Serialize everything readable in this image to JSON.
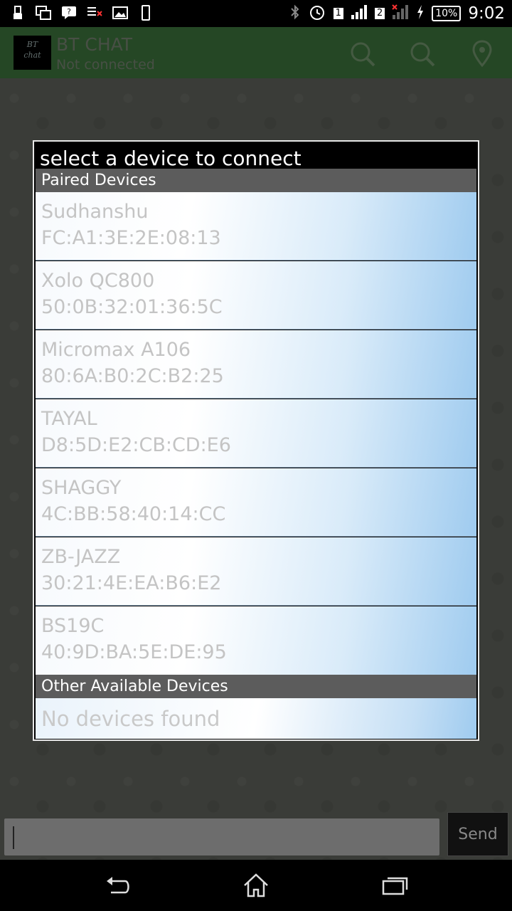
{
  "status_bar": {
    "sim1": "1",
    "sim2": "2",
    "battery": "10%",
    "clock": "9:02"
  },
  "action_bar": {
    "logo_line1": "BT",
    "logo_line2": "chat",
    "title": "BT CHAT",
    "subtitle": "Not connected",
    "icons": [
      "search-icon",
      "search-icon",
      "location-icon"
    ]
  },
  "dialog": {
    "title": "select a device to connect",
    "paired_header": "Paired Devices",
    "paired": [
      {
        "name": "Sudhanshu",
        "address": "FC:A1:3E:2E:08:13"
      },
      {
        "name": "Xolo QC800",
        "address": "50:0B:32:01:36:5C"
      },
      {
        "name": "Micromax A106",
        "address": "80:6A:B0:2C:B2:25"
      },
      {
        "name": "TAYAL",
        "address": "D8:5D:E2:CB:CD:E6"
      },
      {
        "name": "SHAGGY",
        "address": "4C:BB:58:40:14:CC"
      },
      {
        "name": "ZB-JAZZ",
        "address": "30:21:4E:EA:B6:E2"
      },
      {
        "name": "BS19C",
        "address": "40:9D:BA:5E:DE:95"
      }
    ],
    "other_header": "Other Available Devices",
    "other_empty": "No devices found"
  },
  "composer": {
    "input_value": "",
    "send_label": "Send"
  },
  "nav": {
    "icons": [
      "back-icon",
      "home-icon",
      "recents-icon"
    ]
  },
  "colors": {
    "action_bar": "#3a6e3a",
    "section_header": "#5c5c5c",
    "device_text": "#c4c4c4"
  }
}
